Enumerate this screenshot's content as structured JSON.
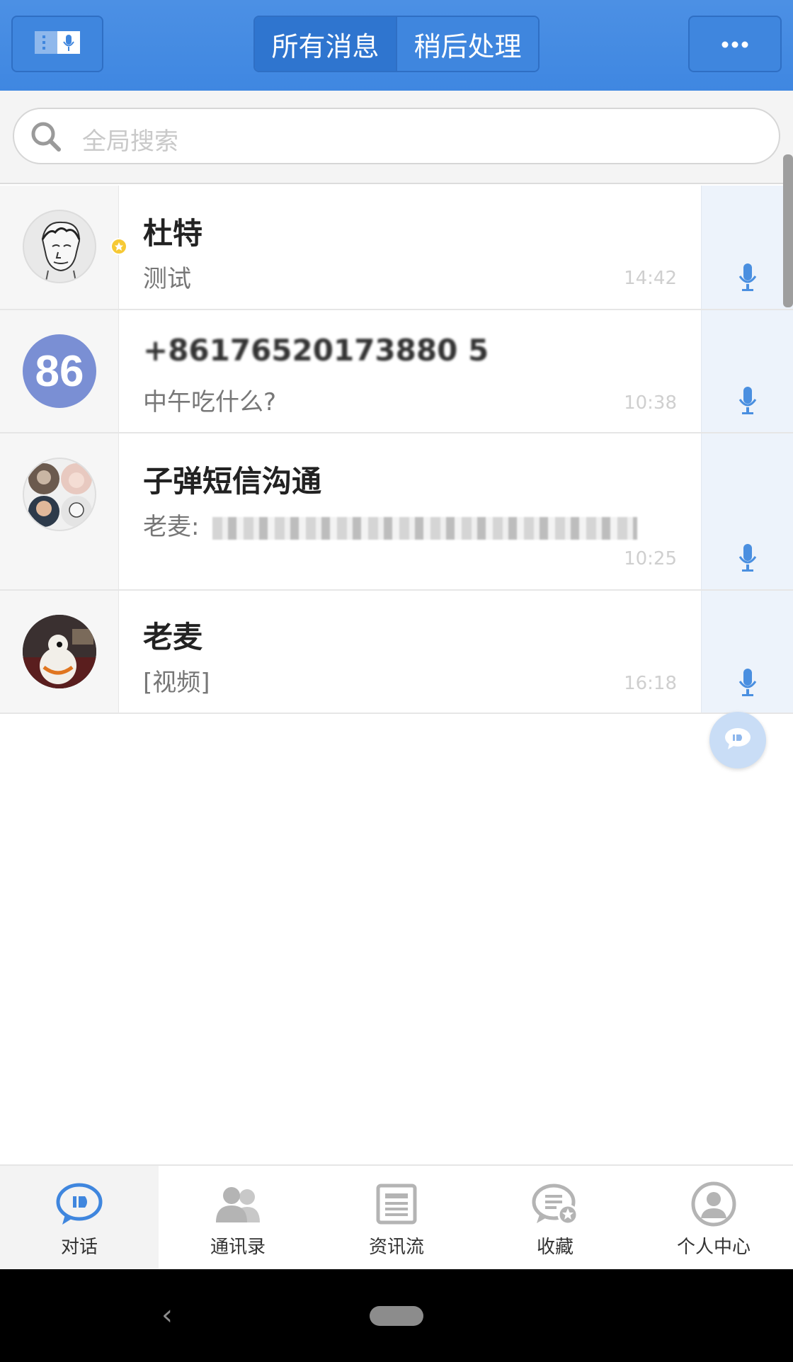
{
  "header": {
    "tabs": [
      {
        "label": "所有消息",
        "active": true
      },
      {
        "label": "稍后处理",
        "active": false
      }
    ],
    "left_icon": "keypad-mic-icon",
    "right_icon": "more-icon",
    "accent_color": "#3f87e1"
  },
  "search": {
    "placeholder": "全局搜索",
    "icon": "search-icon"
  },
  "conversations": [
    {
      "name": "杜特",
      "preview": "测试",
      "time": "14:42",
      "starred": true,
      "avatar": "sketch-avatar"
    },
    {
      "name": "+86176520173880 5",
      "preview": "中午吃什么?",
      "time": "10:38",
      "starred": false,
      "avatar": "86-avatar",
      "avatar_text": "86",
      "name_obscured": true
    },
    {
      "name": "子弹短信沟通",
      "preview": "老麦:",
      "time": "10:25",
      "starred": false,
      "avatar": "group-avatar",
      "preview_obscured": true
    },
    {
      "name": "老麦",
      "preview": "[视频]",
      "time": "16:18",
      "starred": false,
      "avatar": "robot-avatar"
    }
  ],
  "fab_icon": "new-message-icon",
  "bottom_nav": [
    {
      "label": "对话",
      "icon": "chat-icon",
      "active": true
    },
    {
      "label": "通讯录",
      "icon": "contacts-icon",
      "active": false
    },
    {
      "label": "资讯流",
      "icon": "news-icon",
      "active": false
    },
    {
      "label": "收藏",
      "icon": "favorites-icon",
      "active": false
    },
    {
      "label": "个人中心",
      "icon": "profile-icon",
      "active": false
    }
  ],
  "system_nav": {
    "back_glyph": "‹",
    "home_icon": "home-pill-icon"
  }
}
